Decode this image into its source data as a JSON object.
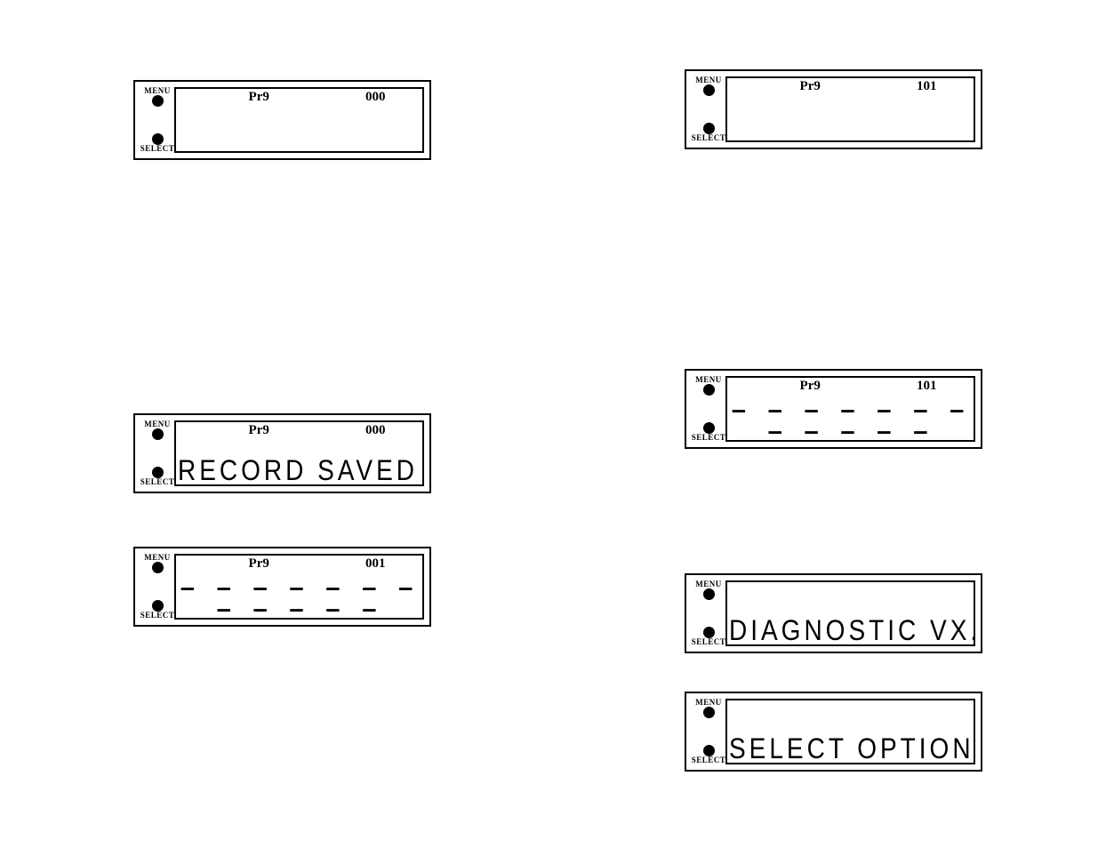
{
  "labels": {
    "menu": "MENU",
    "select": "SELECT"
  },
  "dash_text": "– – – – – – – – – – – –",
  "panels": [
    {
      "key": "p1",
      "prg": "Pr9",
      "num": "000",
      "line2": "",
      "dashes": false,
      "show_line1": true
    },
    {
      "key": "p2",
      "prg": "Pr9",
      "num": "000",
      "line2": "RECORD SAVED . . .",
      "dashes": false,
      "show_line1": true
    },
    {
      "key": "p3",
      "prg": "Pr9",
      "num": "001",
      "line2": "",
      "dashes": true,
      "show_line1": true
    },
    {
      "key": "p4",
      "prg": "Pr9",
      "num": "101",
      "line2": "",
      "dashes": false,
      "show_line1": true
    },
    {
      "key": "p5",
      "prg": "Pr9",
      "num": "101",
      "line2": "",
      "dashes": true,
      "show_line1": true
    },
    {
      "key": "p6",
      "prg": "",
      "num": "",
      "line2": "DIAGNOSTIC VX.X",
      "dashes": false,
      "show_line1": false
    },
    {
      "key": "p7",
      "prg": "",
      "num": "",
      "line2": "SELECT OPTIONS:",
      "dashes": false,
      "show_line1": false
    }
  ]
}
